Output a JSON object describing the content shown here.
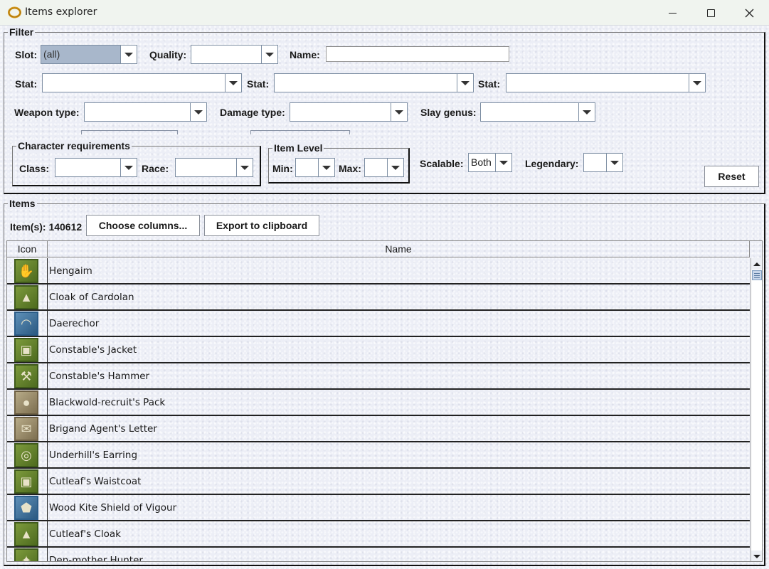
{
  "window": {
    "title": "Items explorer",
    "app_icon": "ring-icon",
    "controls": {
      "minimize": "—",
      "maximize": "☐",
      "close": "✕"
    }
  },
  "filter": {
    "group_title": "Filter",
    "slot": {
      "label": "Slot:",
      "value": "(all)"
    },
    "quality": {
      "label": "Quality:",
      "value": ""
    },
    "name": {
      "label": "Name:",
      "value": ""
    },
    "stats": [
      {
        "label": "Stat:",
        "value": ""
      },
      {
        "label": "Stat:",
        "value": ""
      },
      {
        "label": "Stat:",
        "value": ""
      }
    ],
    "weapon_type": {
      "label": "Weapon type:",
      "value": ""
    },
    "damage_type": {
      "label": "Damage type:",
      "value": ""
    },
    "slay_genus": {
      "label": "Slay genus:",
      "value": ""
    },
    "character_requirements": {
      "group_title": "Character requirements",
      "class": {
        "label": "Class:",
        "value": ""
      },
      "race": {
        "label": "Race:",
        "value": ""
      }
    },
    "item_level": {
      "group_title": "Item Level",
      "min": {
        "label": "Min:",
        "value": ""
      },
      "max": {
        "label": "Max:",
        "value": ""
      }
    },
    "scalable": {
      "label": "Scalable:",
      "value": "Both"
    },
    "legendary": {
      "label": "Legendary:",
      "value": ""
    },
    "reset_label": "Reset"
  },
  "items": {
    "group_title": "Items",
    "count_label": "Item(s): 140612",
    "choose_columns_label": "Choose columns...",
    "export_label": "Export to clipboard",
    "columns": [
      "Icon",
      "Name"
    ],
    "rows": [
      {
        "name": "Hengaim",
        "icon": "gauntlet-icon",
        "glyph": "✋",
        "style": ""
      },
      {
        "name": "Cloak of Cardolan",
        "icon": "cloak-icon",
        "glyph": "▲",
        "style": ""
      },
      {
        "name": "Daerechor",
        "icon": "necklace-icon",
        "glyph": "◠",
        "style": "blue"
      },
      {
        "name": "Constable's Jacket",
        "icon": "jacket-icon",
        "glyph": "▣",
        "style": ""
      },
      {
        "name": "Constable's Hammer",
        "icon": "hammer-icon",
        "glyph": "⚒",
        "style": ""
      },
      {
        "name": "Blackwold-recruit's Pack",
        "icon": "pack-icon",
        "glyph": "●",
        "style": "tan"
      },
      {
        "name": "Brigand Agent's Letter",
        "icon": "letter-icon",
        "glyph": "✉",
        "style": "tan"
      },
      {
        "name": "Underhill's Earring",
        "icon": "earring-icon",
        "glyph": "◎",
        "style": ""
      },
      {
        "name": "Cutleaf's Waistcoat",
        "icon": "waistcoat-icon",
        "glyph": "▣",
        "style": ""
      },
      {
        "name": "Wood Kite Shield of Vigour",
        "icon": "shield-icon",
        "glyph": "⬟",
        "style": "blue"
      },
      {
        "name": "Cutleaf's Cloak",
        "icon": "cloak-icon",
        "glyph": "▲",
        "style": ""
      },
      {
        "name": "Den-mother Hunter",
        "icon": "hunter-icon",
        "glyph": "✦",
        "style": ""
      }
    ]
  }
}
